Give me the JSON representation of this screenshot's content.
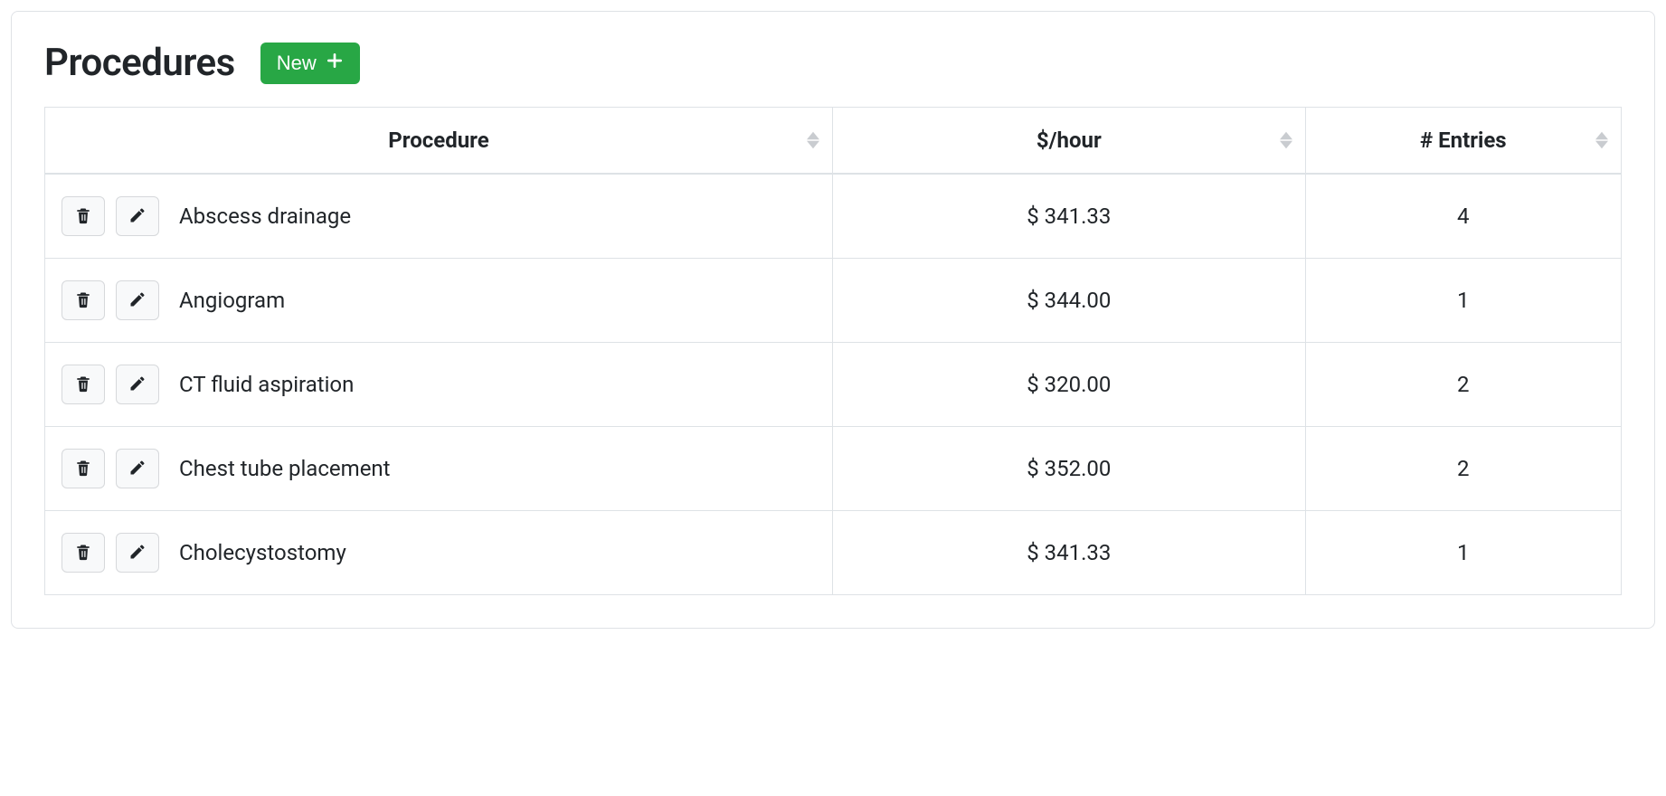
{
  "header": {
    "title": "Procedures",
    "new_button_label": "New"
  },
  "table": {
    "columns": {
      "procedure": "Procedure",
      "rate": "$/hour",
      "entries": "# Entries"
    },
    "currency_prefix": "$ ",
    "rows": [
      {
        "name": "Abscess drainage",
        "rate": "341.33",
        "entries": "4"
      },
      {
        "name": "Angiogram",
        "rate": "344.00",
        "entries": "1"
      },
      {
        "name": "CT fluid aspiration",
        "rate": "320.00",
        "entries": "2"
      },
      {
        "name": "Chest tube placement",
        "rate": "352.00",
        "entries": "2"
      },
      {
        "name": "Cholecystostomy",
        "rate": "341.33",
        "entries": "1"
      }
    ]
  }
}
